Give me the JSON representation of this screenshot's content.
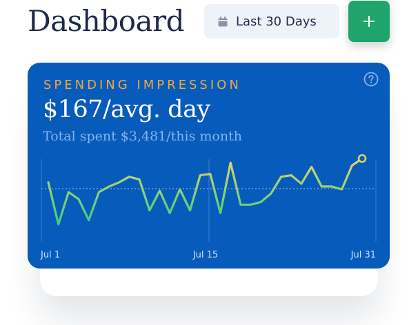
{
  "header": {
    "title": "Dashboard",
    "date_range_label": "Last 30 Days",
    "calendar_icon": "calendar-icon",
    "add_button_icon": "plus-icon",
    "add_button_color": "#1fa56b"
  },
  "card": {
    "kicker": "SPENDING IMPRESSION",
    "headline": "$167/avg. day",
    "subline": "Total spent $3,481/this month",
    "help_icon": "question-circle-icon",
    "background_color": "#075bbb",
    "kicker_color": "#f2a93b"
  },
  "chart_data": {
    "type": "line",
    "title": "",
    "xlabel": "",
    "ylabel": "",
    "x_tick_labels": [
      "Jul 1",
      "Jul 15",
      "Jul 31"
    ],
    "x": [
      1,
      2,
      3,
      4,
      5,
      6,
      7,
      8,
      9,
      10,
      11,
      12,
      13,
      14,
      15,
      16,
      17,
      18,
      19,
      20,
      21,
      22,
      23,
      24,
      25,
      26,
      27,
      28,
      29,
      30,
      31
    ],
    "values": [
      162,
      102,
      148,
      138,
      108,
      148,
      156,
      162,
      170,
      166,
      122,
      150,
      118,
      152,
      122,
      172,
      174,
      118,
      190,
      130,
      130,
      134,
      146,
      170,
      172,
      160,
      184,
      156,
      156,
      152,
      186,
      196
    ],
    "average": 153,
    "ylim": [
      90,
      210
    ],
    "gradient_colors": [
      "#36cf7f",
      "#e6d36c"
    ],
    "highlight_last_point": true,
    "grid": "vertical lines at ticks",
    "legend": "none"
  }
}
